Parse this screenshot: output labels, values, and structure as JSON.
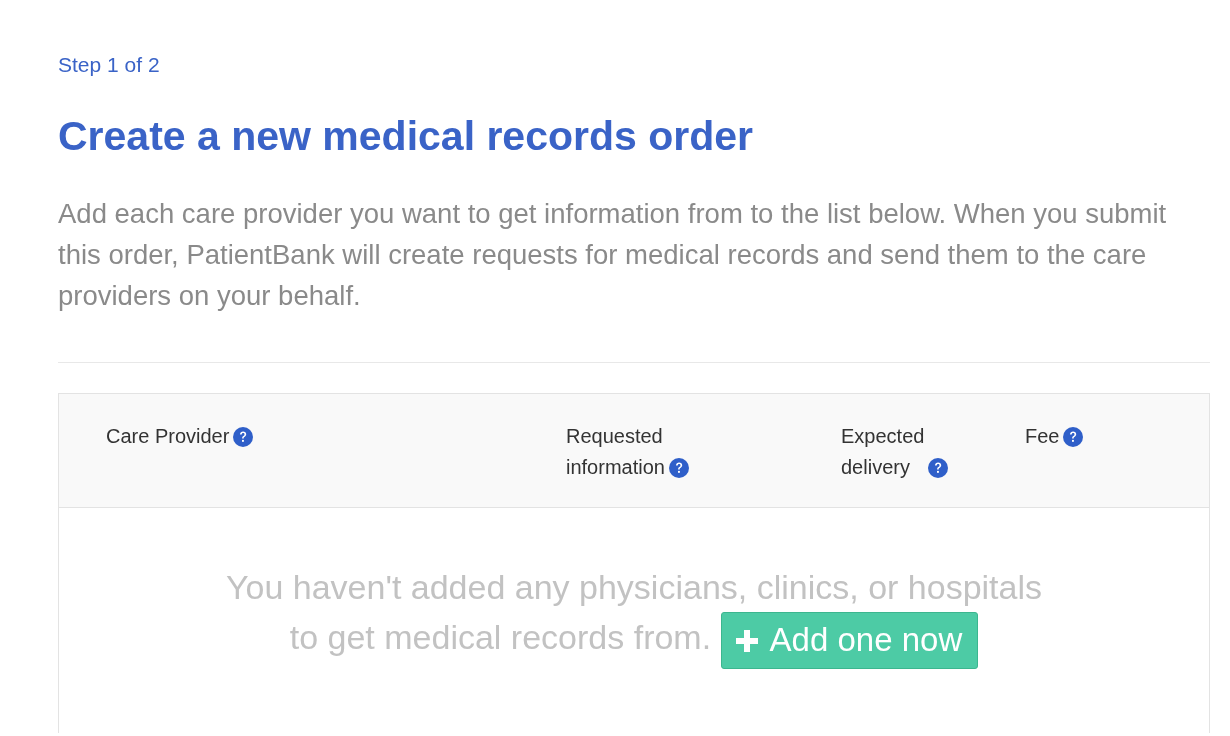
{
  "step": "Step 1 of 2",
  "title": "Create a new medical records order",
  "intro": "Add each care provider you want to get information from to the list below. When you submit this order, PatientBank will create requests for medical records and send them to the care providers on your behalf.",
  "table": {
    "columns": [
      {
        "label": "Care Provider",
        "help": true
      },
      {
        "label": "Requested information",
        "help": true
      },
      {
        "label": "Expected delivery",
        "help": true
      },
      {
        "label": "Fee",
        "help": true
      }
    ],
    "empty_state": {
      "message": "You haven't added any physicians, clinics, or hospitals to get medical records from.",
      "button": "Add one now"
    }
  }
}
